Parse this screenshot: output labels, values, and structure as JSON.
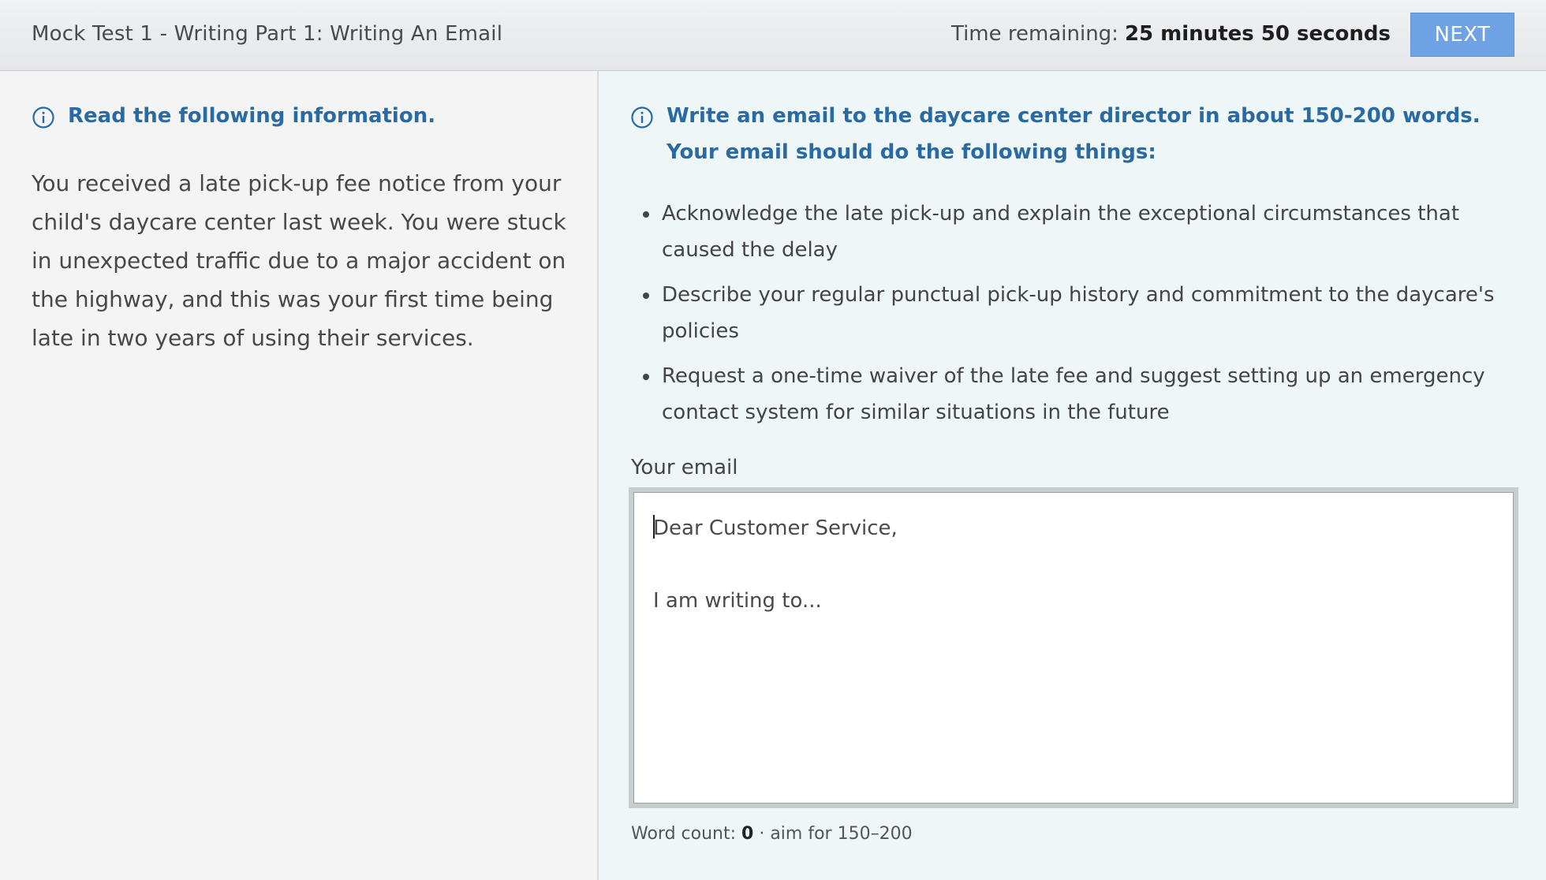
{
  "header": {
    "title": "Mock Test 1 - Writing Part 1: Writing An Email",
    "timer_label": "Time remaining:",
    "timer_value": "25 minutes 50 seconds",
    "next_label": "NEXT"
  },
  "left": {
    "heading": "Read the following information.",
    "body": "You received a late pick-up fee notice from your child's daycare center last week. You were stuck in unexpected traffic due to a major accident on the highway, and this was your first time being late in two years of using their services."
  },
  "right": {
    "heading": "Write an email to the daycare center director in about 150-200 words. Your email should do the following things:",
    "bullets": [
      "Acknowledge the late pick-up and explain the exceptional circumstances that caused the delay",
      "Describe your regular punctual pick-up history and commitment to the daycare's policies",
      "Request a one-time waiver of the late fee and suggest setting up an emergency contact system for similar situations in the future"
    ],
    "email_label": "Your email",
    "email_value": "Dear Customer Service,\n\nI am writing to...",
    "word_count_label": "Word count:",
    "word_count_value": "0",
    "word_count_hint": "· aim for 150–200"
  },
  "icons": {
    "info": "info-circle-icon"
  },
  "colors": {
    "accent": "#2a6aa3",
    "next_button": "#6fa2e4",
    "right_panel_bg": "#eef6f7",
    "left_panel_bg": "#f4f4f4"
  }
}
